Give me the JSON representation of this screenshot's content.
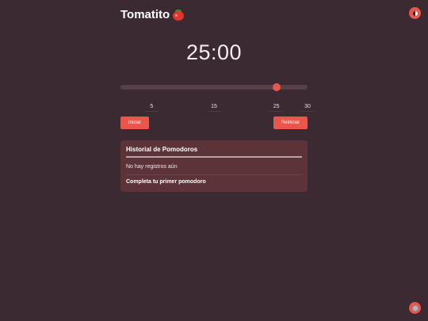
{
  "app": {
    "title": "Tomatito",
    "icon": "tomato-icon"
  },
  "header": {
    "theme_toggle_icon": "half-moon-icon"
  },
  "timer": {
    "display": "25:00"
  },
  "slider": {
    "value": 25,
    "min": 0,
    "max": 30,
    "ticks": [
      "5",
      "15",
      "25",
      "30"
    ],
    "tick_values": [
      5,
      15,
      25,
      30
    ]
  },
  "buttons": {
    "start_label": "Iniciar",
    "reset_label": "Reiniciar"
  },
  "history": {
    "title": "Historial de Pomodoros",
    "empty_text": "No hay registros aún",
    "cta_text": "Completa tu primer pomodoro"
  },
  "footer": {
    "settings_icon": "gear-icon"
  },
  "colors": {
    "background": "#3c2a33",
    "accent": "#e9574a",
    "card": "#5b3339"
  }
}
